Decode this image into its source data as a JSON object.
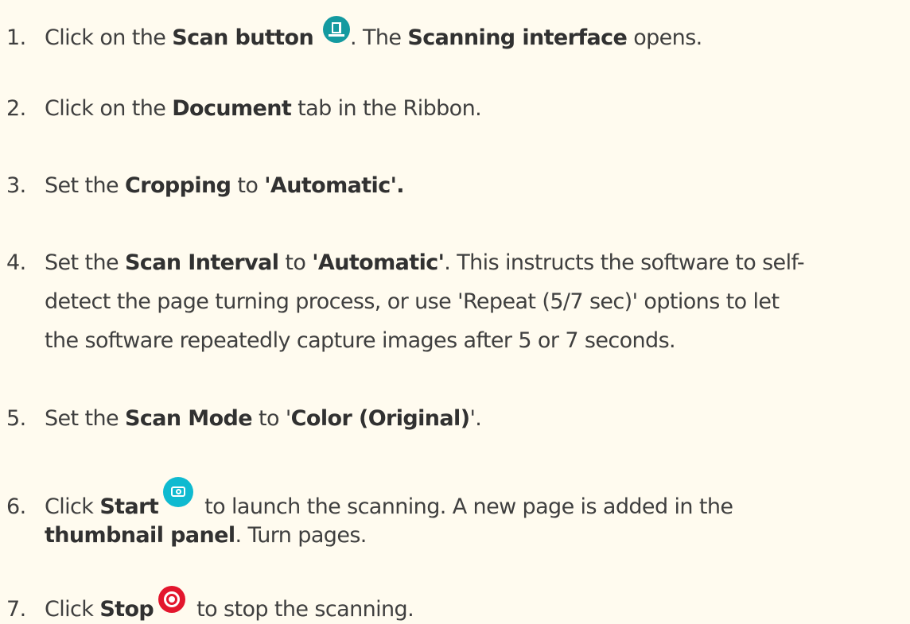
{
  "steps": [
    {
      "number": "1.",
      "t1": "Click on the ",
      "b1": "Scan button",
      "icon": "scan-button-icon",
      "t2": ". The ",
      "b2": "Scanning interface",
      "t3": " opens."
    },
    {
      "number": "2.",
      "t1": "Click on the ",
      "b1": "Document",
      "t2": " tab in the Ribbon."
    },
    {
      "number": "3.",
      "t1": "Set the ",
      "b1": "Cropping",
      "t2": " to ",
      "b2": "'Automatic'."
    },
    {
      "number": "4.",
      "t1": "Set the ",
      "b1": "Scan Interval",
      "t2": " to ",
      "b2": "'Automatic'",
      "t3": ". This instructs the software to self-",
      "line2": "detect the page turning process, or use 'Repeat (5/7 sec)' options to let",
      "line3": "the software repeatedly capture images after 5 or 7 seconds."
    },
    {
      "number": "5.",
      "t1": "Set the ",
      "b1": "Scan Mode",
      "t2": " to '",
      "b2": "Color (Original)",
      "t3": "'."
    },
    {
      "number": "6.",
      "t1": "Click ",
      "b1": "Start",
      "icon": "start-camera-icon",
      "t2": " to launch the scanning. A new page is added in the",
      "b2": "thumbnail panel",
      "t3": ". Turn pages."
    },
    {
      "number": "7.",
      "t1": "Click ",
      "b1": "Stop",
      "icon": "stop-record-icon",
      "t2": " to stop the scanning."
    }
  ],
  "colors": {
    "background": "#fffbef",
    "text": "#3f3f3f",
    "scan_icon": "#149aa0",
    "start_icon": "#0fbad0",
    "stop_icon": "#e3162d"
  }
}
